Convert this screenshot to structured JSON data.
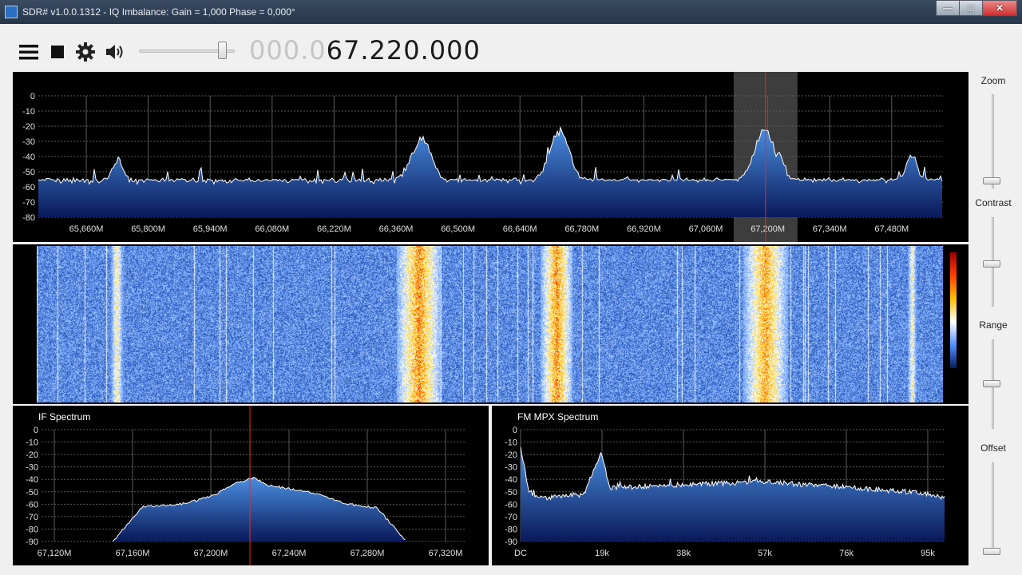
{
  "window": {
    "title": "SDR# v1.0.0.1312 - IQ Imbalance: Gain = 1,000 Phase = 0,000°",
    "minimize_glyph": "—",
    "maximize_glyph": "□",
    "close_glyph": "✕"
  },
  "toolbar": {
    "menu_icon": "hamburger-menu-icon",
    "stop_icon": "stop-icon",
    "settings_icon": "gear-icon",
    "audio_icon": "speaker-icon",
    "volume_level": 0.85,
    "frequency_dim": "000.0",
    "frequency_main": "67.220.000"
  },
  "sidebar": {
    "zoom_label": "Zoom",
    "contrast_label": "Contrast",
    "range_label": "Range",
    "offset_label": "Offset"
  },
  "colors": {
    "spectrum_fill_top": "#4a8ee0",
    "spectrum_fill_bottom": "#0a1a5a",
    "trace": "#ffffff",
    "grid": "#5a5a5a",
    "tuning_line": "#ff2020",
    "filter_band": "#888888"
  },
  "chart_data": [
    {
      "type": "area",
      "panel": "main-spectrum",
      "ylabels": [
        "0",
        "-10",
        "-20",
        "-30",
        "-40",
        "-50",
        "-60",
        "-70",
        "-80"
      ],
      "xlabels": [
        "65,660M",
        "65,800M",
        "65,940M",
        "66,080M",
        "66,220M",
        "66,360M",
        "66,500M",
        "66,640M",
        "66,780M",
        "66,920M",
        "67,060M",
        "67,200M",
        "67,340M",
        "67,480M"
      ],
      "ylim": [
        -80,
        0
      ],
      "xlim_mhz": [
        65.58,
        67.62
      ],
      "tuned_mhz": 67.22,
      "noise_floor_db": -57,
      "peaks": [
        {
          "x": 65.76,
          "y": -42
        },
        {
          "x": 66.445,
          "y": -28
        },
        {
          "x": 66.755,
          "y": -24
        },
        {
          "x": 67.2,
          "y": -42
        },
        {
          "x": 67.218,
          "y": -22
        },
        {
          "x": 67.25,
          "y": -38
        },
        {
          "x": 67.55,
          "y": -40
        }
      ]
    },
    {
      "type": "heatmap",
      "panel": "waterfall",
      "hot_bands_mhz": [
        65.76,
        66.44,
        66.75,
        67.22,
        67.55
      ],
      "colormap": [
        "#0a1a60",
        "#2a5cc0",
        "#7fb0ff",
        "#ffffff",
        "#ffe040",
        "#ff8000",
        "#d00000"
      ]
    },
    {
      "type": "area",
      "panel": "if-spectrum",
      "title": "IF Spectrum",
      "ylabels": [
        "0",
        "-10",
        "-20",
        "-30",
        "-40",
        "-50",
        "-60",
        "-70",
        "-80",
        "-90"
      ],
      "xlabels": [
        "67,120M",
        "67,160M",
        "67,200M",
        "67,240M",
        "67,280M",
        "67,320M"
      ],
      "ylim": [
        -90,
        0
      ],
      "xlim_mhz": [
        67.12,
        67.32
      ],
      "tuned_mhz": 67.22,
      "profile": [
        {
          "x": 67.15,
          "y": -90
        },
        {
          "x": 67.165,
          "y": -62
        },
        {
          "x": 67.185,
          "y": -60
        },
        {
          "x": 67.2,
          "y": -54
        },
        {
          "x": 67.207,
          "y": -48
        },
        {
          "x": 67.212,
          "y": -43
        },
        {
          "x": 67.222,
          "y": -39
        },
        {
          "x": 67.23,
          "y": -45
        },
        {
          "x": 67.25,
          "y": -50
        },
        {
          "x": 67.27,
          "y": -60
        },
        {
          "x": 67.285,
          "y": -63
        },
        {
          "x": 67.3,
          "y": -90
        }
      ]
    },
    {
      "type": "area",
      "panel": "fm-mpx-spectrum",
      "title": "FM MPX Spectrum",
      "ylabels": [
        "0",
        "-10",
        "-20",
        "-30",
        "-40",
        "-50",
        "-60",
        "-70",
        "-80",
        "-90"
      ],
      "xlabels": [
        "DC",
        "19k",
        "38k",
        "57k",
        "76k",
        "95k"
      ],
      "ylim": [
        -90,
        0
      ],
      "xlim_khz": [
        0,
        100
      ],
      "profile": [
        {
          "x": 0,
          "y": -15
        },
        {
          "x": 2,
          "y": -50
        },
        {
          "x": 5,
          "y": -55
        },
        {
          "x": 15,
          "y": -52
        },
        {
          "x": 19,
          "y": -18
        },
        {
          "x": 21,
          "y": -47
        },
        {
          "x": 40,
          "y": -44
        },
        {
          "x": 57,
          "y": -42
        },
        {
          "x": 76,
          "y": -46
        },
        {
          "x": 95,
          "y": -51
        },
        {
          "x": 100,
          "y": -55
        }
      ]
    }
  ]
}
